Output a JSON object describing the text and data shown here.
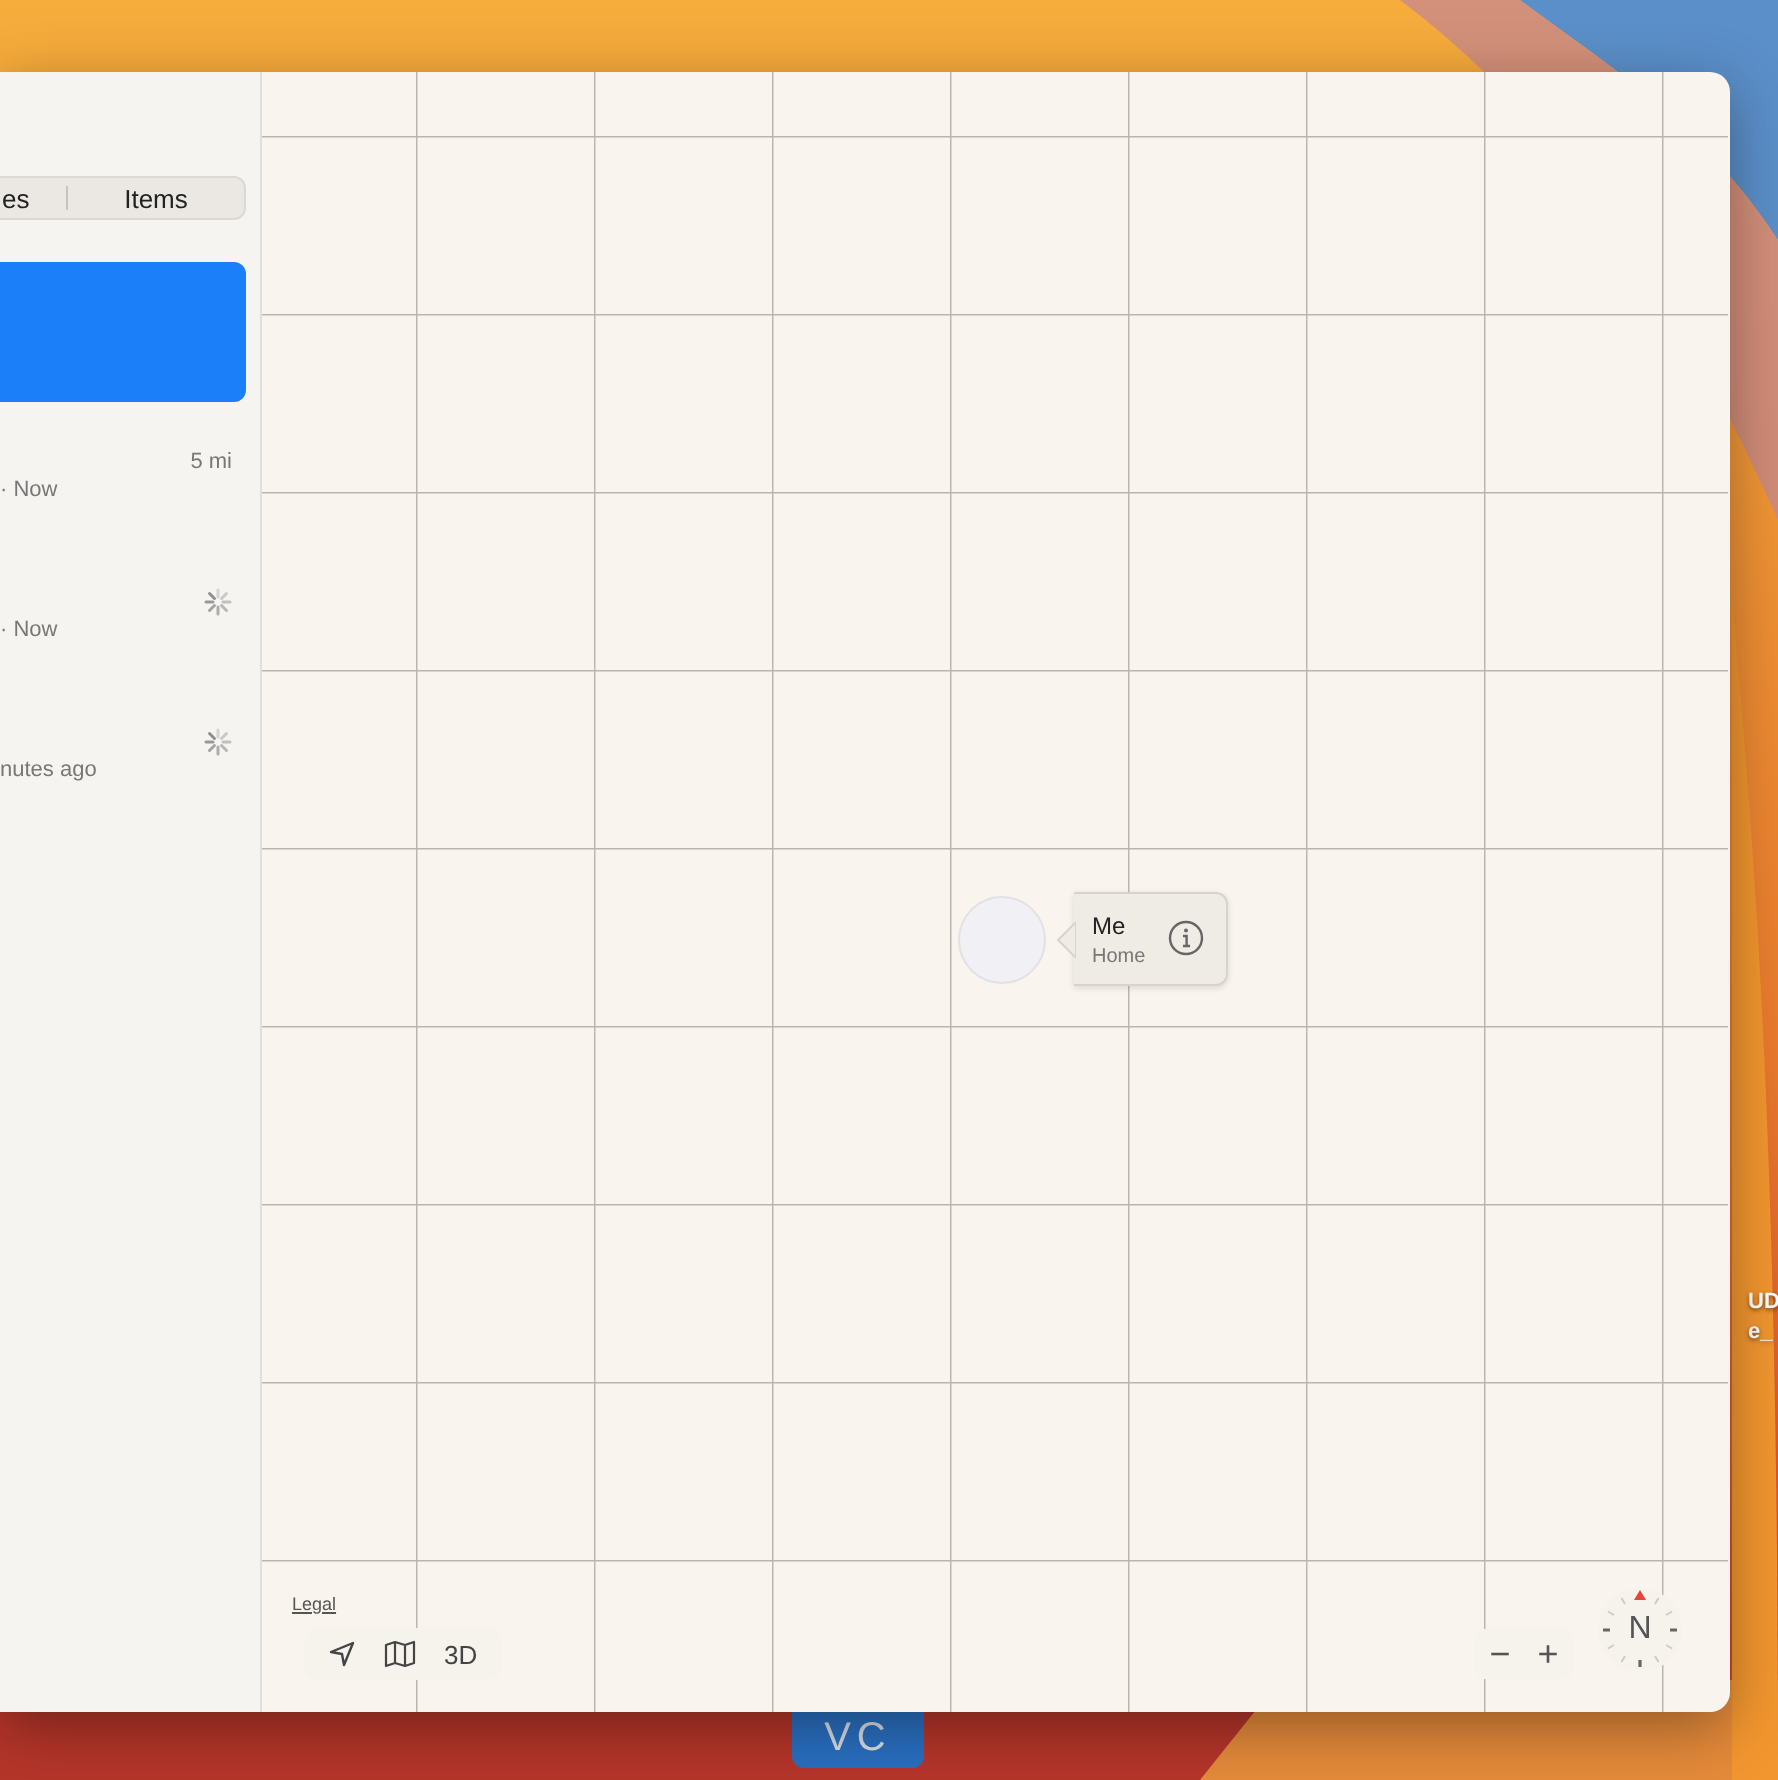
{
  "sidebar": {
    "segments": [
      {
        "label": "es"
      },
      {
        "label": "Items"
      }
    ],
    "rows": [
      {
        "selected": true
      },
      {
        "selected": false,
        "distance": "5 mi",
        "subtitle": "· Now",
        "loading": false
      },
      {
        "selected": false,
        "subtitle": "· Now",
        "loading": true
      },
      {
        "selected": false,
        "subtitle": "nutes ago",
        "loading": true
      }
    ]
  },
  "map": {
    "pin": {
      "title": "Me",
      "subtitle": "Home"
    },
    "legal": "Legal",
    "view_button": "3D",
    "zoom_out": "−",
    "zoom_in": "+",
    "compass": "N"
  },
  "desktop": {
    "labels": [
      "UD",
      "e_"
    ],
    "dock_icon": "VC"
  }
}
